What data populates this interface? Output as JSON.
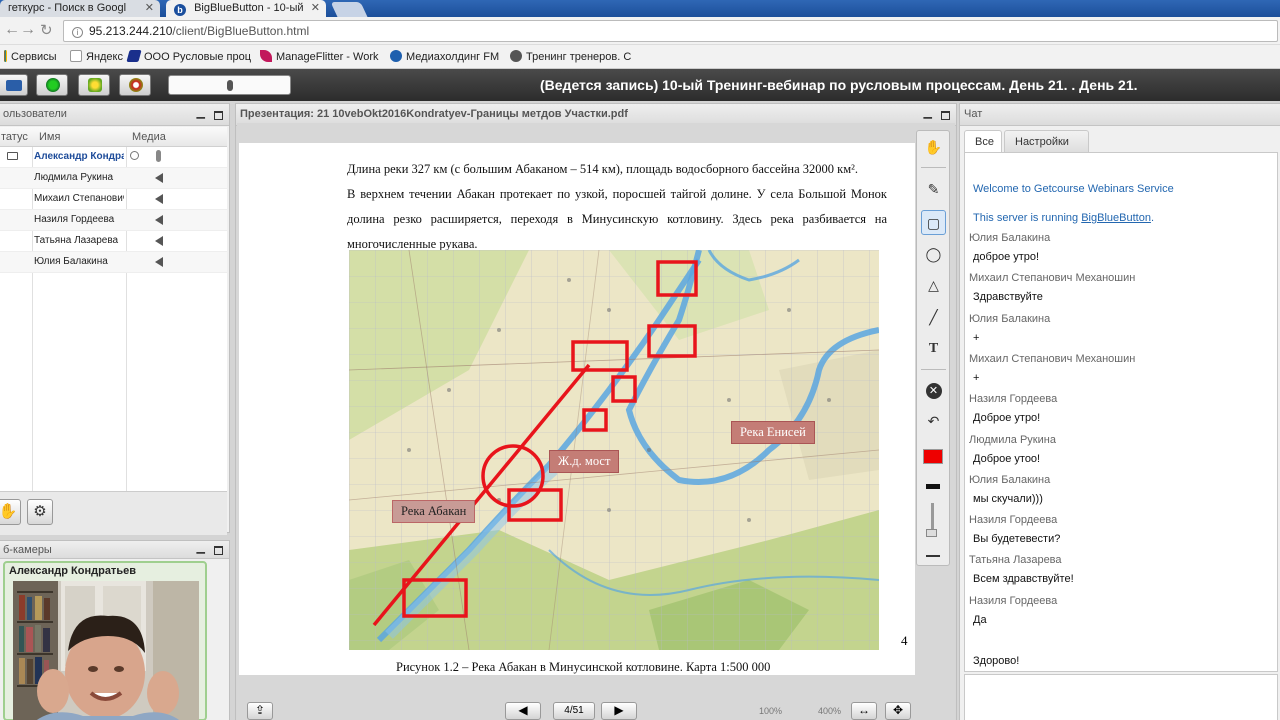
{
  "browser": {
    "tabs": [
      {
        "label": "геткурс - Поиск в Googl",
        "active": false
      },
      {
        "label": "BigBlueButton - 10-ый",
        "active": true
      }
    ],
    "url_host": "95.213.244.210",
    "url_path": "/client/BigBlueButton.html",
    "bookmarks": [
      "Сервисы",
      "Яндекс",
      "ООО Русловые проц",
      "ManageFlitter - Work",
      "Медиахолдинг FM",
      "Тренинг тренеров. С"
    ]
  },
  "toolbar": {
    "title": "(Ведется запись) 10-ый Тренинг-вебинар по русловым процессам. День 21. . День 21."
  },
  "users": {
    "title": "ользователи",
    "columns": [
      "татус",
      "Имя",
      "Медиа"
    ],
    "rows": [
      {
        "name": "Александр Кондра",
        "presenter": true
      },
      {
        "name": "Людмила Рукина",
        "presenter": false
      },
      {
        "name": "Михаил Степанович",
        "presenter": false
      },
      {
        "name": "Назиля Гордеева",
        "presenter": false
      },
      {
        "name": "Татьяна Лазарева",
        "presenter": false
      },
      {
        "name": "Юлия Балакина",
        "presenter": false
      }
    ]
  },
  "webcam": {
    "title": "б-камеры",
    "name": "Александр Кондратьев"
  },
  "presentation": {
    "title": "Презентация: 21 10vebOkt2016Kondratyev-Границы метдов Участки.pdf",
    "paragraph1": "Длина реки 327 км (с большим Абаканом – 514 км), площадь водосборного бассейна 32000 км².",
    "paragraph2": "В верхнем течении Абакан протекает по узкой, поросшей тайгой долине. У села Большой Монок долина резко расширяется, переходя в Минусинскую котловину. Здесь река разбивается на многочисленные рукава.",
    "map_labels": {
      "abakan": "Река Абакан",
      "bridge": "Ж.д. мост",
      "yenisei": "Река Енисей"
    },
    "page_number": "4",
    "caption": "Рисунок 1.2 – Река Абакан в Минусинской котловине. Карта 1:500 000",
    "page_indicator": "4/51",
    "zoom_label_left": "100%",
    "zoom_label_right": "400%"
  },
  "chat": {
    "title": "Чат",
    "tabs": [
      "Все",
      "Настройки"
    ],
    "welcome": "Welcome to Getcourse Webinars Service",
    "server_prefix": "This server is running ",
    "server_link": "BigBlueButton",
    "server_suffix": ".",
    "messages": [
      {
        "name": "Юлия Балакина",
        "text": "доброе утро!"
      },
      {
        "name": "Михаил Степанович Механошин",
        "text": "Здравствуйте"
      },
      {
        "name": "Юлия Балакина",
        "text": "+"
      },
      {
        "name": "Михаил Степанович Механошин",
        "text": "+"
      },
      {
        "name": "Назиля Гордеева",
        "text": "Доброе утро!"
      },
      {
        "name": "Людмила Рукина",
        "text": "Доброе утоо!"
      },
      {
        "name": "Юлия Балакина",
        "text": "мы скучали)))"
      },
      {
        "name": "Назиля Гордеева",
        "text": "Вы будетевести?"
      },
      {
        "name": "Татьяна Лазарева",
        "text": "Всем здравствуйте!"
      },
      {
        "name": "Назиля Гордеева",
        "text": "Да"
      }
    ],
    "last_text": "Здорово!"
  },
  "colors": {
    "accent": "#2367b0",
    "toolbar_bg": "#333333",
    "annotation_red": "#e8141b",
    "selected_color": "#ee0000"
  }
}
